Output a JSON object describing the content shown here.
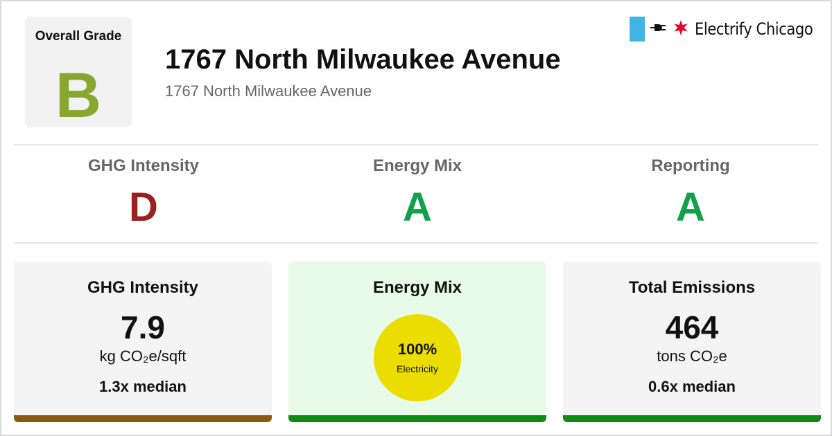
{
  "header": {
    "overall_label": "Overall Grade",
    "overall_grade": "B",
    "title": "1767 North Milwaukee Avenue",
    "subtitle": "1767 North Milwaukee Avenue",
    "brand": "Electrify Chicago"
  },
  "grades": [
    {
      "label": "GHG Intensity",
      "grade": "D"
    },
    {
      "label": "Energy Mix",
      "grade": "A"
    },
    {
      "label": "Reporting",
      "grade": "A"
    }
  ],
  "cards": {
    "ghg": {
      "title": "GHG Intensity",
      "value": "7.9",
      "unit": "kg CO₂e/sqft",
      "median": "1.3x median"
    },
    "mix": {
      "title": "Energy Mix",
      "percent": "100%",
      "source": "Electricity"
    },
    "total": {
      "title": "Total Emissions",
      "value": "464",
      "unit": "tons CO₂e",
      "median": "0.6x median"
    }
  },
  "colors": {
    "grade_b": "#86a831",
    "grade_d": "#9b2020",
    "grade_a": "#12a04a",
    "bar_ghg": "#8a5a12",
    "bar_mix": "#0f8a12",
    "bar_total": "#0f8a12",
    "electricity_circle": "#ecdd00",
    "flag_blue": "#41b6e6",
    "star_red": "#e4002b"
  },
  "icons": {
    "brand_flag": "chicago-flag-stripe",
    "brand_plug": "plug-icon",
    "brand_star": "chicago-star-icon"
  }
}
